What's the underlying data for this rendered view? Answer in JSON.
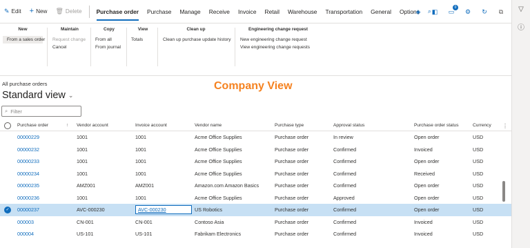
{
  "commandbar": {
    "edit": "Edit",
    "new": "New",
    "delete": "Delete",
    "tabs": [
      "Purchase order",
      "Purchase",
      "Manage",
      "Receive",
      "Invoice",
      "Retail",
      "Warehouse",
      "Transportation",
      "General",
      "Options"
    ],
    "notification_count": "0"
  },
  "ribbon": {
    "new_title": "New",
    "new_item": "From a sales order",
    "maintain_title": "Maintain",
    "maintain_items": [
      "Request change",
      "Cancel"
    ],
    "copy_title": "Copy",
    "copy_items": [
      "From all",
      "From journal"
    ],
    "view_title": "View",
    "view_items": [
      "Totals"
    ],
    "cleanup_title": "Clean up",
    "cleanup_items": [
      "Clean up purchase update history"
    ],
    "ecr_title": "Engineering change request",
    "ecr_items": [
      "New engineering change request",
      "View engineering change requests"
    ]
  },
  "page": {
    "breadcrumb": "All purchase orders",
    "view_title": "Standard view",
    "overlay_label": "Company View",
    "filter_placeholder": "Filter"
  },
  "grid": {
    "headers": [
      "Purchase order",
      "Vendor account",
      "Invoice account",
      "Vendor name",
      "Purchase type",
      "Approval status",
      "Purchase order status",
      "Currency"
    ],
    "sort_indicator": "↑",
    "rows": [
      {
        "po": "00000229",
        "vendor": "1001",
        "invoice": "1001",
        "name": "Acme Office Supplies",
        "type": "Purchase order",
        "approval": "In review",
        "status": "Open order",
        "currency": "USD"
      },
      {
        "po": "00000232",
        "vendor": "1001",
        "invoice": "1001",
        "name": "Acme Office Supplies",
        "type": "Purchase order",
        "approval": "Confirmed",
        "status": "Invoiced",
        "currency": "USD"
      },
      {
        "po": "00000233",
        "vendor": "1001",
        "invoice": "1001",
        "name": "Acme Office Supplies",
        "type": "Purchase order",
        "approval": "Confirmed",
        "status": "Open order",
        "currency": "USD"
      },
      {
        "po": "00000234",
        "vendor": "1001",
        "invoice": "1001",
        "name": "Acme Office Supplies",
        "type": "Purchase order",
        "approval": "Confirmed",
        "status": "Received",
        "currency": "USD"
      },
      {
        "po": "00000235",
        "vendor": "AMZ001",
        "invoice": "AMZ001",
        "name": "Amazon.com Amazon Basics",
        "type": "Purchase order",
        "approval": "Confirmed",
        "status": "Open order",
        "currency": "USD"
      },
      {
        "po": "00000236",
        "vendor": "1001",
        "invoice": "1001",
        "name": "Acme Office Supplies",
        "type": "Purchase order",
        "approval": "Approved",
        "status": "Open order",
        "currency": "USD"
      },
      {
        "po": "00000237",
        "vendor": "AVC-000230",
        "invoice": "AVC-000230",
        "name": "US Robotics",
        "type": "Purchase order",
        "approval": "Confirmed",
        "status": "Open order",
        "currency": "USD"
      },
      {
        "po": "000003",
        "vendor": "CN-001",
        "invoice": "CN-001",
        "name": "Contoso Asia",
        "type": "Purchase order",
        "approval": "Confirmed",
        "status": "Invoiced",
        "currency": "USD"
      },
      {
        "po": "000004",
        "vendor": "US-101",
        "invoice": "US-101",
        "name": "Fabrikam Electronics",
        "type": "Purchase order",
        "approval": "Confirmed",
        "status": "Invoiced",
        "currency": "USD"
      }
    ]
  },
  "colors": {
    "accent": "#0f6cbd",
    "overlay": "#f58220",
    "selected_row": "#c7e0f4"
  }
}
